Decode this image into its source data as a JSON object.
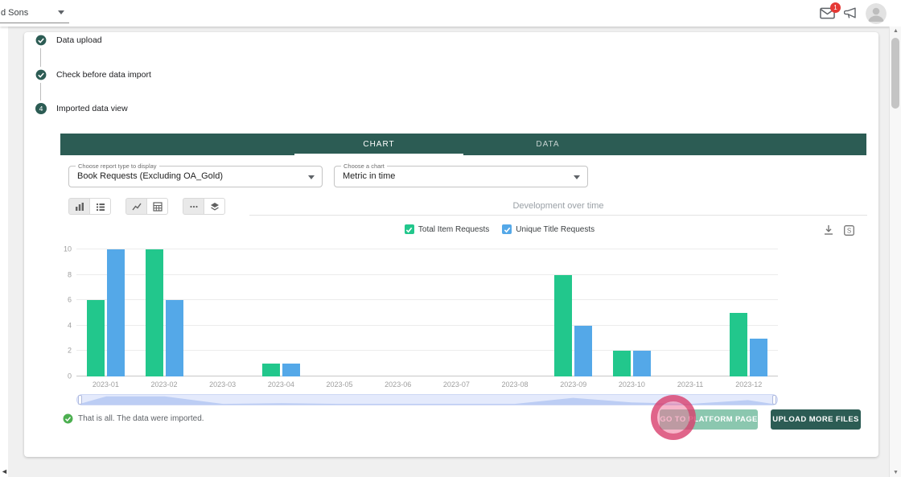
{
  "colors": {
    "primary_teal": "#2c5c54",
    "bar_green": "#22c78c",
    "bar_blue": "#54a8e8",
    "go_button_teal": "#8bc7af",
    "highlight_pink": "#d02e5f",
    "badge_red": "#e53935"
  },
  "topbar": {
    "account_select_value": "d Sons",
    "notifications_badge": "1",
    "icons": [
      "mail-icon",
      "megaphone-icon",
      "avatar"
    ]
  },
  "stepper": {
    "steps": [
      {
        "label": "Data upload",
        "state": "completed"
      },
      {
        "label": "Check before data import",
        "state": "completed"
      },
      {
        "label": "Imported data view",
        "state": "active",
        "number": "4"
      }
    ]
  },
  "tabs": [
    {
      "label": "CHART",
      "active": true
    },
    {
      "label": "DATA",
      "active": false
    }
  ],
  "filters": {
    "report_type": {
      "label": "Choose report type to display",
      "value": "Book Requests (Excluding OA_Gold)"
    },
    "chart_select": {
      "label": "Choose a chart",
      "value": "Metric in time"
    }
  },
  "toolbar_icons": [
    "bar-chart-icon",
    "list-icon",
    "line-chart-icon",
    "grid-icon",
    "ellipsis-icon",
    "layers-icon"
  ],
  "export_icons": [
    "download-icon",
    "export-image-icon"
  ],
  "status": {
    "text": "That is all. The data were imported."
  },
  "buttons": {
    "go_to_platform": "GO TO PLATFORM PAGE",
    "upload_more": "UPLOAD MORE FILES"
  },
  "chart_data": {
    "type": "bar",
    "title": "Development over time",
    "categories": [
      "2023-01",
      "2023-02",
      "2023-03",
      "2023-04",
      "2023-05",
      "2023-06",
      "2023-07",
      "2023-08",
      "2023-09",
      "2023-10",
      "2023-11",
      "2023-12"
    ],
    "series": [
      {
        "name": "Total Item Requests",
        "color": "#22c78c",
        "checked": true,
        "values": [
          6,
          10,
          0,
          1,
          0,
          0,
          0,
          0,
          8,
          2,
          0,
          5
        ]
      },
      {
        "name": "Unique Title Requests",
        "color": "#54a8e8",
        "checked": true,
        "values": [
          10,
          6,
          0,
          1,
          0,
          0,
          0,
          0,
          4,
          2,
          0,
          3
        ]
      }
    ],
    "ylim": [
      0,
      10
    ],
    "yticks": [
      0,
      2,
      4,
      6,
      8,
      10
    ],
    "grid": true,
    "legend_position": "top"
  }
}
